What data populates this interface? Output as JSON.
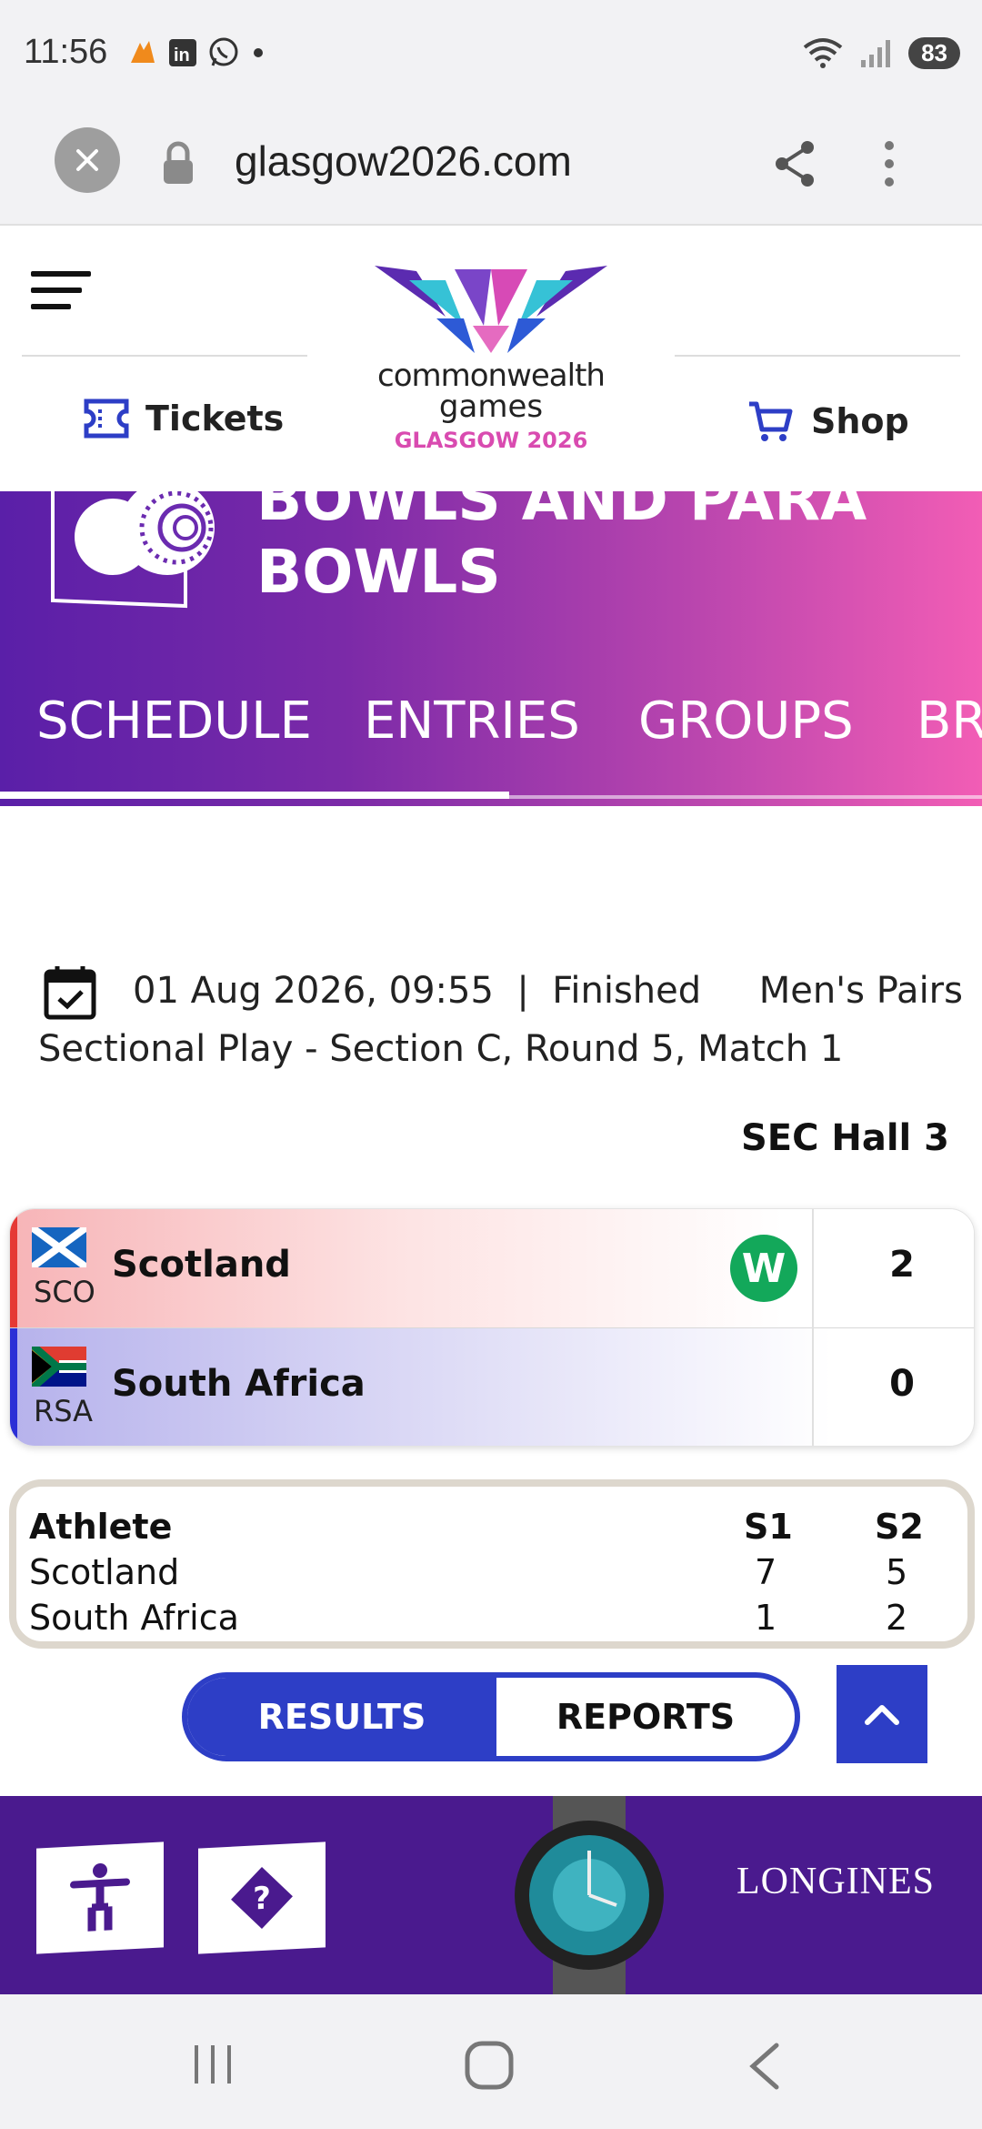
{
  "status_bar": {
    "time": "11:56",
    "battery": "83",
    "icons_left": [
      "fire-app-icon",
      "linkedin-icon",
      "whatsapp-icon",
      "dot-icon"
    ],
    "icons_right": [
      "wifi-icon",
      "signal-icon",
      "battery-icon"
    ]
  },
  "browser": {
    "url": "glasgow2026.com"
  },
  "header": {
    "logo_line1": "commonwealth",
    "logo_line2": "games",
    "logo_line3": "GLASGOW 2026",
    "tickets_label": "Tickets",
    "shop_label": "Shop"
  },
  "banner": {
    "title_line1": "BOWLS AND PARA",
    "title_line2": "BOWLS",
    "tabs": [
      {
        "label": "SCHEDULE"
      },
      {
        "label": "ENTRIES"
      },
      {
        "label": "GROUPS"
      },
      {
        "label": "BR"
      }
    ]
  },
  "match": {
    "datetime_status_event": "01 Aug 2026, 09:55  |  Finished     Men's Pairs",
    "phase": "Sectional Play - Section C, Round 5, Match 1",
    "venue": "SEC Hall 3",
    "teams": [
      {
        "code": "SCO",
        "name": "Scotland",
        "badge": "W",
        "score": "2"
      },
      {
        "code": "RSA",
        "name": "South Africa",
        "score": "0"
      }
    ]
  },
  "sets": {
    "headers": [
      "Athlete",
      "S1",
      "S2"
    ],
    "rows": [
      [
        "Scotland",
        "7",
        "5"
      ],
      [
        "South Africa",
        "1",
        "2"
      ]
    ]
  },
  "toggle": {
    "results_label": "RESULTS",
    "reports_label": "REPORTS",
    "active": "RESULTS"
  },
  "footer": {
    "sponsor": "LONGINES"
  },
  "colors": {
    "accent_blue": "#2d3ec6",
    "win_green": "#13a85a",
    "footer_purple": "#4a1a8e",
    "logo_pink": "#d94bb0"
  }
}
